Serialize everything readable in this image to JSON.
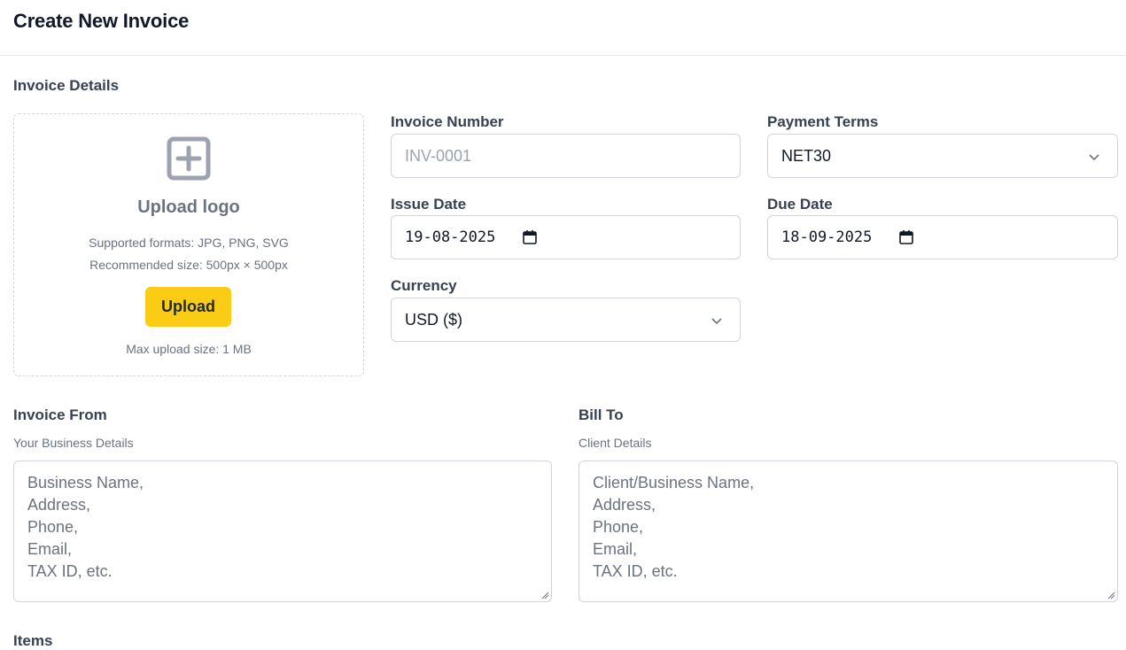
{
  "header": {
    "title": "Create New Invoice"
  },
  "invoice_details": {
    "section_title": "Invoice Details",
    "upload": {
      "icon": "plus-square-icon",
      "title": "Upload logo",
      "formats": "Supported formats: JPG, PNG, SVG",
      "size": "Recommended size: 500px × 500px",
      "button_label": "Upload",
      "max_size": "Max upload size: 1 MB"
    },
    "invoice_number": {
      "label": "Invoice Number",
      "placeholder": "INV-0001",
      "value": ""
    },
    "payment_terms": {
      "label": "Payment Terms",
      "value": "NET30"
    },
    "issue_date": {
      "label": "Issue Date",
      "value": "19-08-2025"
    },
    "due_date": {
      "label": "Due Date",
      "value": "18-09-2025"
    },
    "currency": {
      "label": "Currency",
      "value": "USD ($)"
    }
  },
  "invoice_from": {
    "title": "Invoice From",
    "subtitle": "Your Business Details",
    "placeholder_lines": [
      "Business Name,",
      "Address,",
      "Phone,",
      "Email,",
      "TAX ID, etc."
    ]
  },
  "bill_to": {
    "title": "Bill To",
    "subtitle": "Client Details",
    "placeholder_lines": [
      "Client/Business Name,",
      "Address,",
      "Phone,",
      "Email,",
      "TAX ID, etc."
    ]
  },
  "items": {
    "title": "Items"
  },
  "colors": {
    "accent": "#facc15",
    "border": "#d1d5db",
    "muted_text": "#6b7280"
  }
}
